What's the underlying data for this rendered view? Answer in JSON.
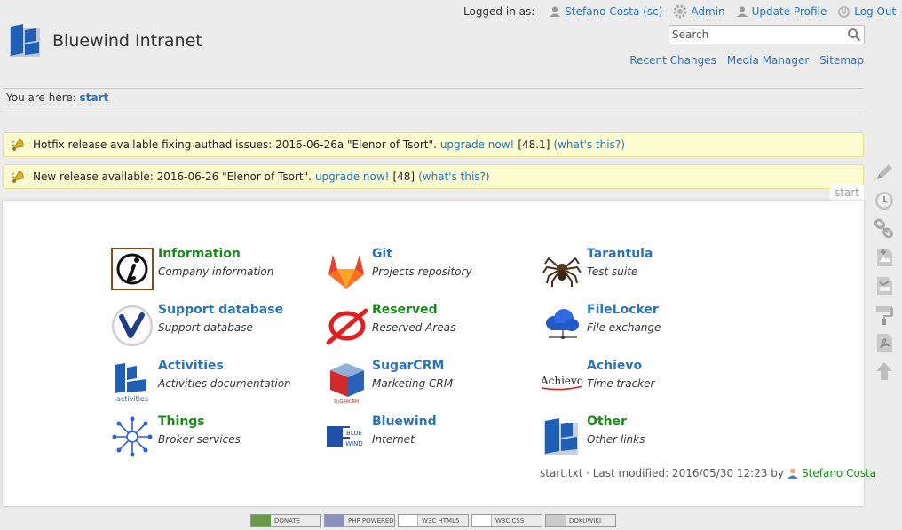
{
  "header": {
    "site_title": "Bluewind Intranet",
    "logged_in_label": "Logged in as:",
    "user_link": "Stefano Costa (sc)",
    "admin": "Admin",
    "update_profile": "Update Profile",
    "logout": "Log Out",
    "search_placeholder": "Search",
    "site_tools": [
      "Recent Changes",
      "Media Manager",
      "Sitemap"
    ]
  },
  "breadcrumb": {
    "label": "You are here:",
    "page": "start"
  },
  "notices": [
    {
      "text": "Hotfix release available fixing authad issues: 2016-06-26a \"Elenor of Tsort\".",
      "link": "upgrade now!",
      "version": "[48.1]",
      "whats": "(what's this?)"
    },
    {
      "text": "New release available: 2016-06-26 \"Elenor of Tsort\".",
      "link": "upgrade now!",
      "version": "[48]",
      "whats": "(what's this?)"
    }
  ],
  "page_id": "start",
  "grid": [
    {
      "title": "Information",
      "desc": "Company information",
      "icon": "information-icon",
      "internal": true
    },
    {
      "title": "Git",
      "desc": "Projects repository",
      "icon": "gitlab-icon",
      "internal": false
    },
    {
      "title": "Tarantula",
      "desc": "Test suite",
      "icon": "tarantula-icon",
      "internal": false
    },
    {
      "title": "Support database",
      "desc": "Support database",
      "icon": "support-database-icon",
      "internal": false
    },
    {
      "title": "Reserved",
      "desc": "Reserved Areas",
      "icon": "reserved-icon",
      "internal": true
    },
    {
      "title": "FileLocker",
      "desc": "File exchange",
      "icon": "filelocker-cloud-icon",
      "internal": false
    },
    {
      "title": "Activities",
      "desc": "Activities documentation",
      "icon": "activities-icon",
      "internal": false
    },
    {
      "title": "SugarCRM",
      "desc": "Marketing CRM",
      "icon": "sugarcrm-icon",
      "internal": false
    },
    {
      "title": "Achievo",
      "desc": "Time tracker",
      "icon": "achievo-icon",
      "internal": false
    },
    {
      "title": "Things",
      "desc": "Broker services",
      "icon": "things-network-icon",
      "internal": true
    },
    {
      "title": "Bluewind",
      "desc": "Internet",
      "icon": "bluewind-icon",
      "internal": false
    },
    {
      "title": "Other",
      "desc": "Other links",
      "icon": "other-icon",
      "internal": true
    }
  ],
  "docinfo": {
    "text": "start.txt · Last modified: 2016/05/30 12:23 by",
    "author": "Stefano Costa"
  },
  "page_tools": [
    "edit-page-icon",
    "old-revisions-icon",
    "backlinks-icon",
    "export-odt-icon",
    "export-pdf-icon",
    "subscribe-icon",
    "export-pdf-alt-icon",
    "back-to-top-icon"
  ],
  "footer_badges": [
    "DONATE",
    "PHP POWERED",
    "W3C HTML5",
    "W3C CSS",
    "DOKUWIKI"
  ],
  "colors": {
    "link": "#2b73b7",
    "internal_link": "#1a8a1a",
    "notice_bg": "#fbfbd0",
    "brand_blue": "#1f5fb5"
  }
}
